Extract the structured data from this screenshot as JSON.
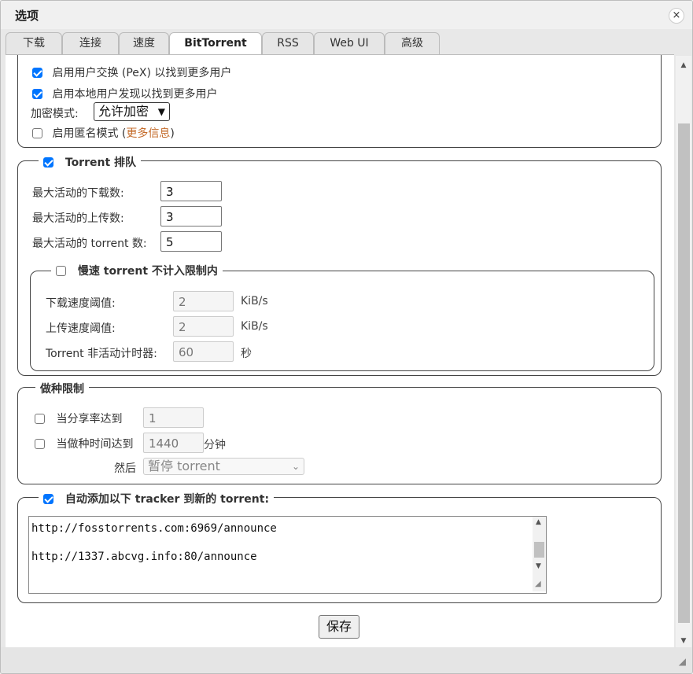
{
  "window": {
    "title": "选项",
    "close_icon": "×"
  },
  "tabs": [
    {
      "label": "下载"
    },
    {
      "label": "连接"
    },
    {
      "label": "速度"
    },
    {
      "label": "BitTorrent",
      "active": true
    },
    {
      "label": "RSS"
    },
    {
      "label": "Web UI"
    },
    {
      "label": "高级"
    }
  ],
  "privacy": {
    "pex": {
      "label": "启用用户交换 (PeX) 以找到更多用户",
      "checked": true
    },
    "lsd": {
      "label": "启用本地用户发现以找到更多用户",
      "checked": true
    },
    "encryption_label": "加密模式:",
    "encryption_value": "允许加密",
    "anonymous_label": "启用匿名模式 (",
    "anonymous_link": "更多信息",
    "anonymous_suffix": ")",
    "anonymous_checked": false
  },
  "queueing": {
    "legend": "Torrent 排队",
    "checked": true,
    "max_downloads_label": "最大活动的下载数:",
    "max_downloads": "3",
    "max_uploads_label": "最大活动的上传数:",
    "max_uploads": "3",
    "max_torrents_label": "最大活动的 torrent 数:",
    "max_torrents": "5",
    "slow": {
      "legend": "慢速 torrent 不计入限制内",
      "checked": false,
      "dl_label": "下载速度阈值:",
      "dl_value": "2",
      "dl_unit": "KiB/s",
      "ul_label": "上传速度阈值:",
      "ul_value": "2",
      "ul_unit": "KiB/s",
      "timer_label": "Torrent 非活动计时器:",
      "timer_value": "60",
      "timer_unit": "秒"
    }
  },
  "seeding": {
    "legend": "做种限制",
    "ratio_label": "当分享率达到",
    "ratio_value": "1",
    "ratio_checked": false,
    "time_label": "当做种时间达到",
    "time_value": "1440",
    "time_unit": "分钟",
    "time_checked": false,
    "then_label": "然后",
    "then_value": "暂停 torrent"
  },
  "trackers": {
    "legend": "自动添加以下 tracker 到新的 torrent:",
    "checked": true,
    "lines": [
      "http://fosstorrents.com:6969/announce",
      "http://1337.abcvg.info:80/announce"
    ]
  },
  "save_label": "保存"
}
